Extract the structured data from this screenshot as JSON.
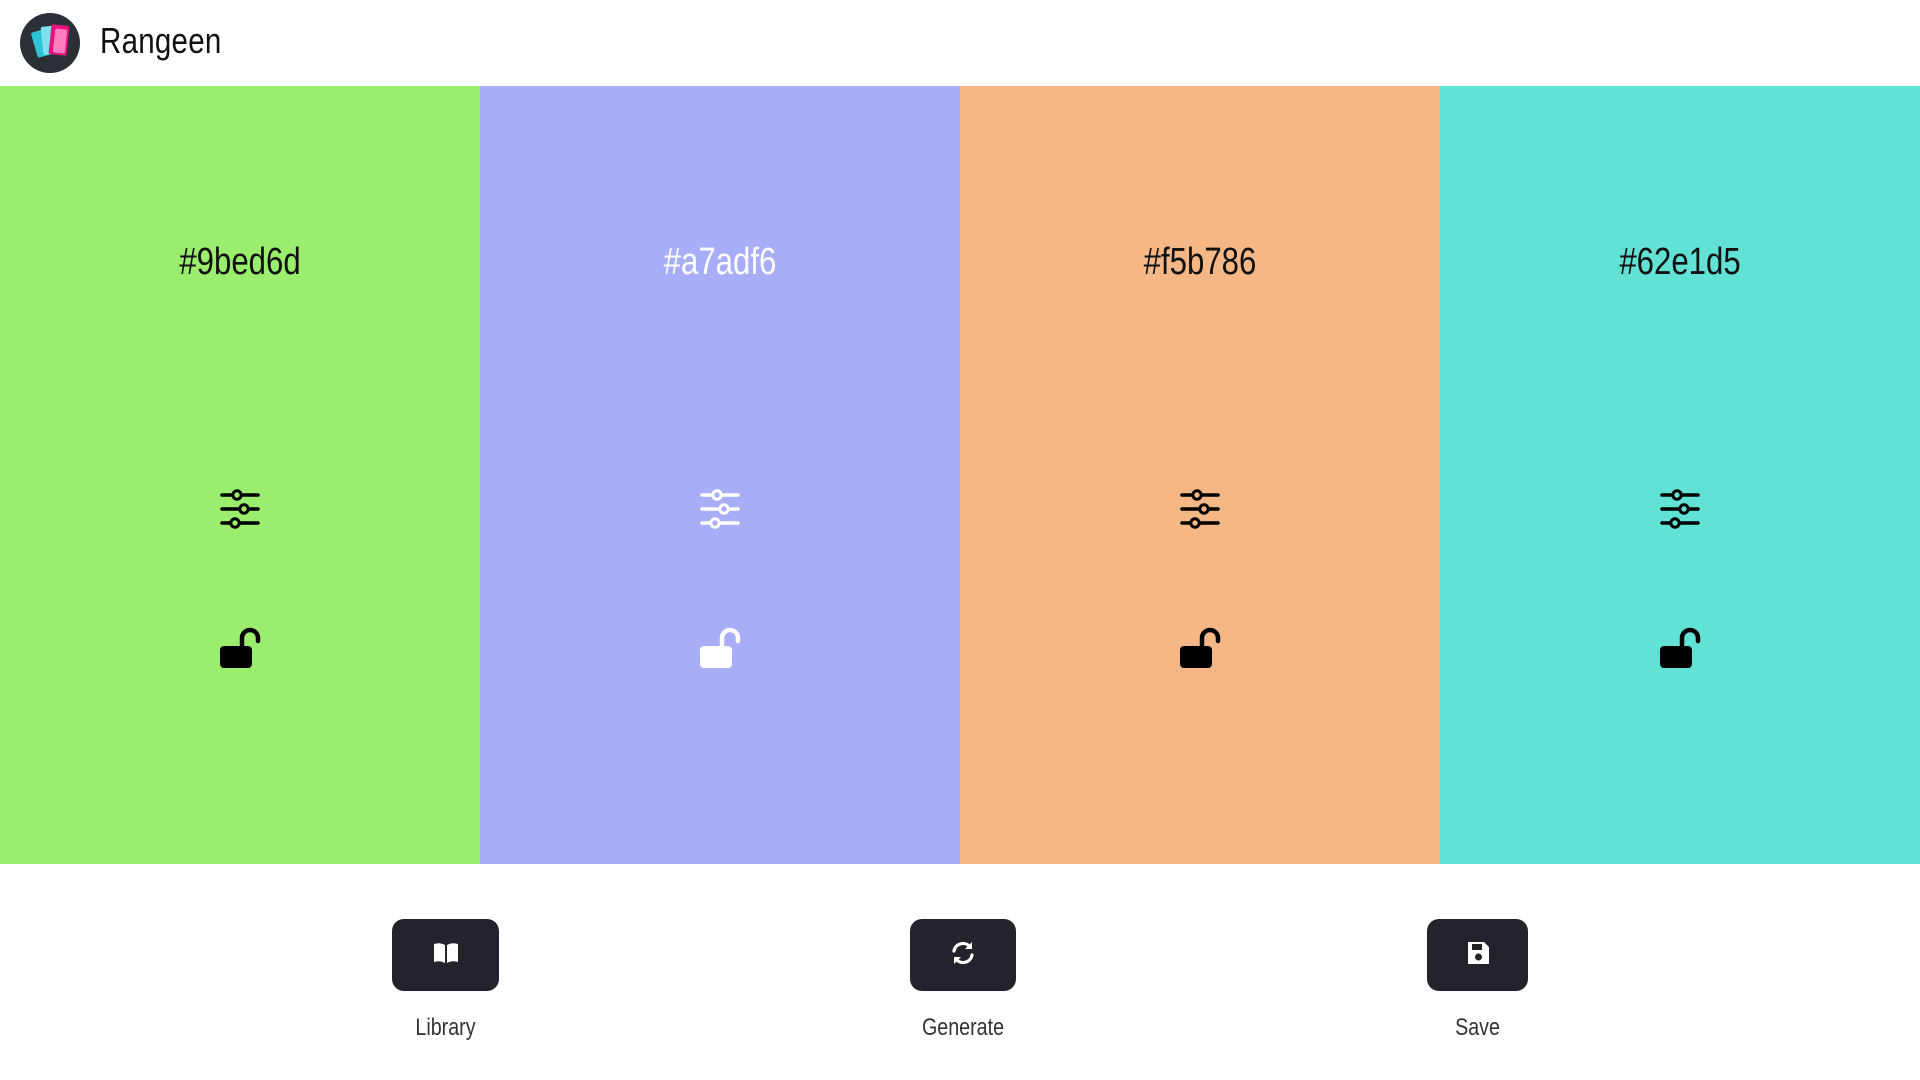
{
  "app": {
    "title": "Rangeen"
  },
  "palette": [
    {
      "hex": "#9bed6d",
      "color": "#9bed6d",
      "text_color": "#111111",
      "icon_color": "#000000",
      "locked": false
    },
    {
      "hex": "#a7adf6",
      "color": "#a7adf6",
      "text_color": "#ffffff",
      "icon_color": "#ffffff",
      "locked": false
    },
    {
      "hex": "#f5b786",
      "color": "#f5b786",
      "text_color": "#111111",
      "icon_color": "#000000",
      "locked": false
    },
    {
      "hex": "#62e1d5",
      "color": "#62e1d5",
      "text_color": "#111111",
      "icon_color": "#000000",
      "locked": false
    }
  ],
  "controls": [
    {
      "label": "Library",
      "icon": "book-icon"
    },
    {
      "label": "Generate",
      "icon": "refresh-icon"
    },
    {
      "label": "Save",
      "icon": "floppy-disk-icon"
    }
  ],
  "colors": {
    "button_bg": "#23232b",
    "button_icon": "#ffffff"
  }
}
